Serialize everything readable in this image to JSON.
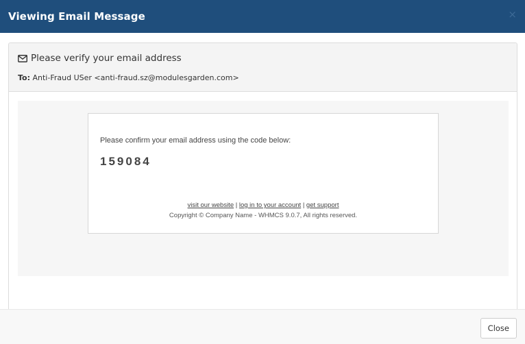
{
  "modal": {
    "title": "Viewing Email Message",
    "close_glyph": "×"
  },
  "message": {
    "icon": "envelope-icon",
    "subject": "Please verify your email address",
    "to_label": "To:",
    "to_value": "Anti-Fraud USer <anti-fraud.sz@modulesgarden.com>"
  },
  "email": {
    "intro": "Please confirm your email address using the code below:",
    "code": "159084",
    "links": {
      "website": "visit our website",
      "separator": "|",
      "login": "log in to your account",
      "support": "get support"
    },
    "copyright": "Copyright © Company Name - WHMCS 9.0.7, All rights reserved."
  },
  "footer": {
    "close_label": "Close"
  },
  "colors": {
    "header_bg": "#1f4e7c",
    "header_text": "#ffffff"
  }
}
